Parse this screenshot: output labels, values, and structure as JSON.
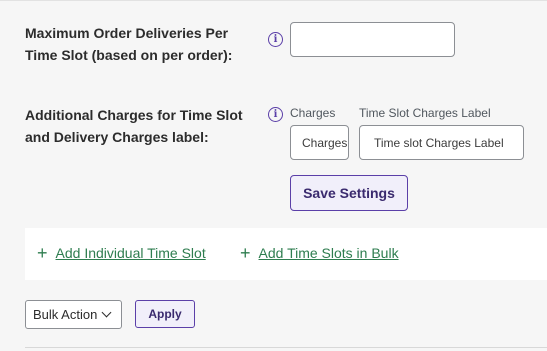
{
  "max_orders": {
    "label_line1": "Maximum Order Deliveries Per",
    "label_line2": "Time Slot (based on per order):",
    "value": ""
  },
  "additional_charges": {
    "label_line1": "Additional Charges for Time Slot",
    "label_line2": "and Delivery Charges label:",
    "charges_caption": "Charges",
    "charges_placeholder": "Charges",
    "charges_label_caption": "Time Slot Charges Label",
    "charges_label_placeholder": "Time slot Charges Label"
  },
  "save_button": "Save Settings",
  "links": {
    "add_individual": "Add Individual Time Slot",
    "add_bulk": "Add Time Slots in Bulk"
  },
  "bulk": {
    "select_value": "Bulk Action",
    "apply_label": "Apply"
  },
  "icons": {
    "info": "info-icon",
    "plus": "plus-icon",
    "chevron": "chevron-down-icon"
  },
  "colors": {
    "accent": "#5b3fa8",
    "link": "#2e7d4f"
  }
}
